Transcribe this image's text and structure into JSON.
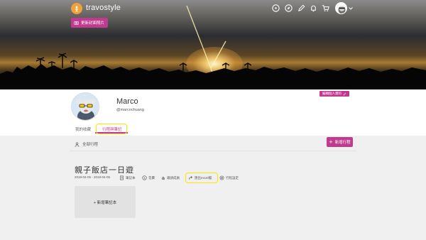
{
  "header": {
    "brand": "travostyle",
    "icons": [
      "compass-icon",
      "explore-icon",
      "pen-icon",
      "bell-icon",
      "cart-icon"
    ],
    "change_cover_label": "更新封面照片"
  },
  "profile": {
    "name": "Marco",
    "handle": "@marcochuang",
    "edit_label": "編輯個人資料"
  },
  "tabs": [
    {
      "label": "我的收藏",
      "active": false
    },
    {
      "label": "行程與筆記",
      "active": true
    }
  ],
  "toolbar": {
    "filter_label": "全部行程",
    "new_trip_label": "新增行程"
  },
  "trip": {
    "title": "親子飯店一日遊",
    "dates": "2018-04-05 - 2018-04-05",
    "notes_label": "筆記本",
    "cost_label": "花費",
    "members_label": "邀請成員",
    "export_label": "匯出excel檔",
    "settings_label": "行程設定",
    "add_note_label": "+ 新增筆記本"
  },
  "colors": {
    "accent": "#c03a8e",
    "highlight": "#ffe200",
    "logo": "#f0a13a"
  }
}
